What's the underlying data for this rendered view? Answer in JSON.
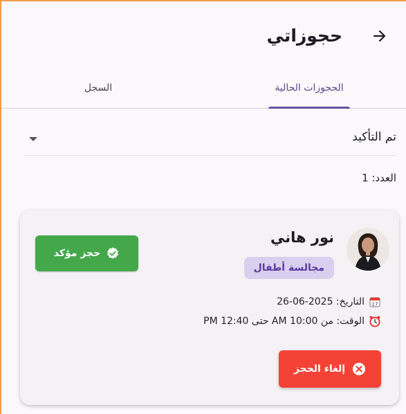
{
  "appbar": {
    "title": "حجوزاتي",
    "back_icon": "arrow-right-icon"
  },
  "tabs": [
    {
      "label": "الحجوزات الحالية",
      "active": true
    },
    {
      "label": "السجل",
      "active": false
    }
  ],
  "filter": {
    "value": "تم التأكيد"
  },
  "count_text": "العدد: 1",
  "booking": {
    "name": "نور هاني",
    "service": "مجالسة أطفال",
    "status": "حجز مؤكد",
    "date_text": "التاريخ: 2025-06-26",
    "time_text": "الوقت: من 10:00 AM حتى 12:40 PM",
    "cancel_label": "إلغاء الحجز"
  },
  "colors": {
    "primary": "#6750a4",
    "confirmed": "#44a84b",
    "cancel": "#f44336",
    "chip_bg": "#d9cfee"
  }
}
